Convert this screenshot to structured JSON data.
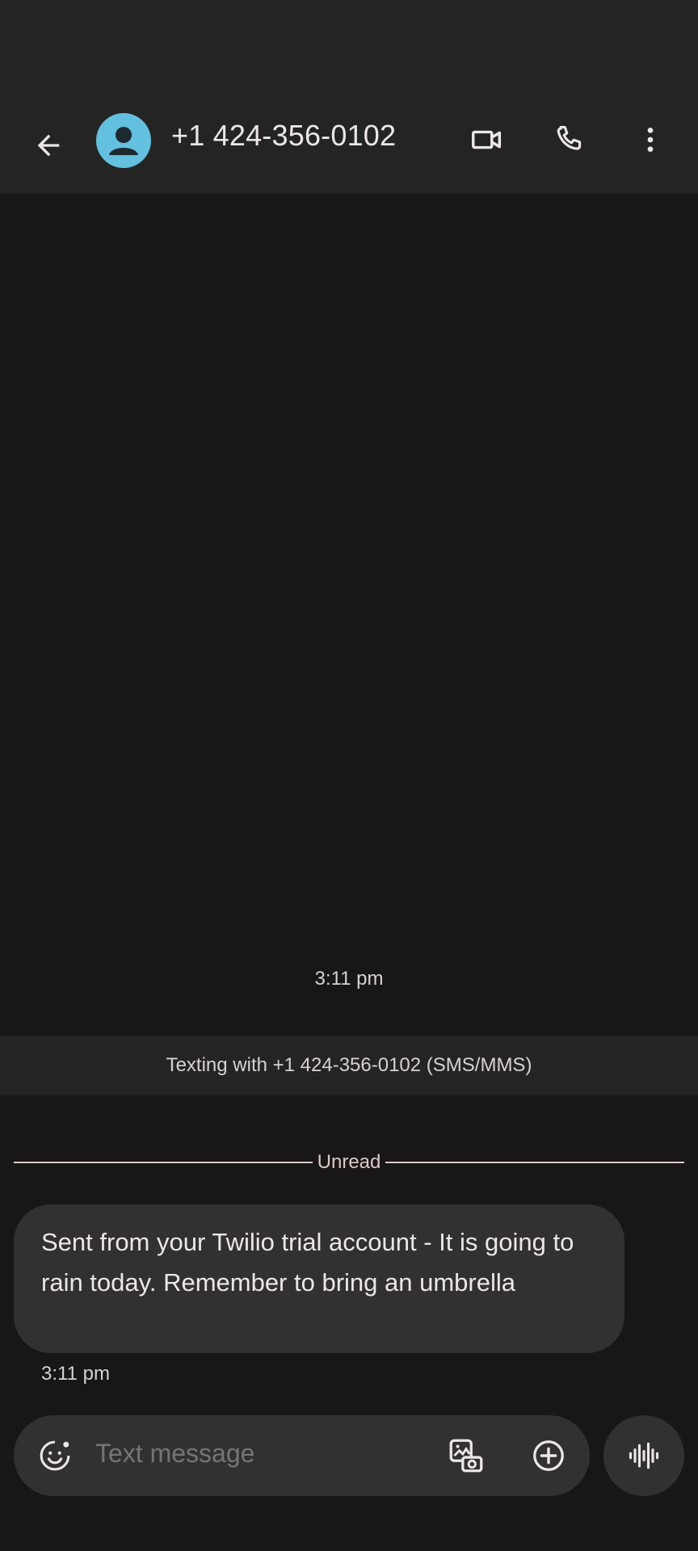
{
  "header": {
    "contact_name": "+1 424-356-0102",
    "avatar_color": "#63c0df",
    "back_icon": "arrow-back-icon",
    "actions": [
      "video-call-icon",
      "phone-icon",
      "more-vert-icon"
    ]
  },
  "conversation": {
    "top_timestamp": "3:11 pm",
    "texting_banner": "Texting with +1 424-356-0102 (SMS/MMS)",
    "unread_label": "Unread",
    "messages": [
      {
        "text": "Sent from your Twilio trial account - It is going to rain today. Remember to bring an umbrella",
        "time": "3:11 pm",
        "direction": "incoming"
      }
    ]
  },
  "composer": {
    "placeholder": "Text message",
    "icons": [
      "emoji-icon",
      "gallery-icon",
      "add-icon",
      "voice-waveform-icon"
    ]
  },
  "colors": {
    "background": "#191616",
    "top_bar": "#252424",
    "bubble": "#333030",
    "text": "#ece7e7",
    "divider": "#d9cbc9"
  }
}
